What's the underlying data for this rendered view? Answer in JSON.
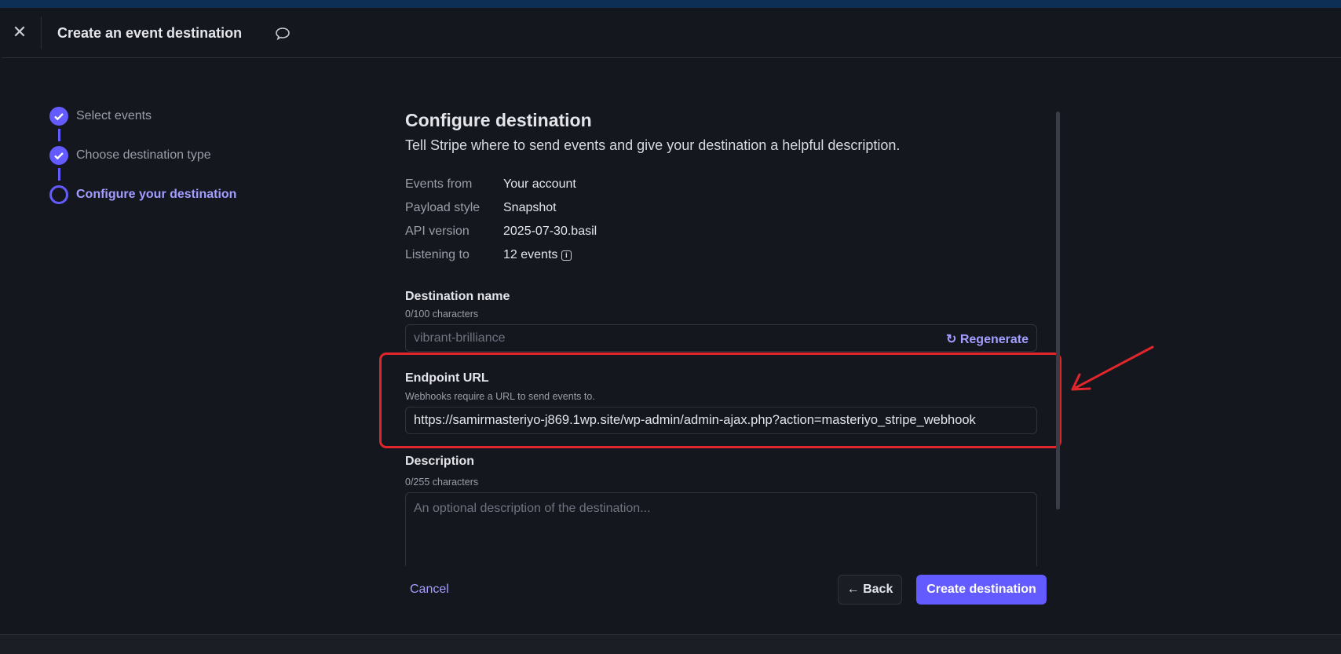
{
  "header": {
    "title": "Create an event destination"
  },
  "steps": [
    {
      "label": "Select events",
      "state": "done"
    },
    {
      "label": "Choose destination type",
      "state": "done"
    },
    {
      "label": "Configure your destination",
      "state": "current"
    }
  ],
  "main": {
    "heading": "Configure destination",
    "subtitle": "Tell Stripe where to send events and give your destination a helpful description.",
    "meta": [
      {
        "label": "Events from",
        "value": "Your account"
      },
      {
        "label": "Payload style",
        "value": "Snapshot"
      },
      {
        "label": "API version",
        "value": "2025-07-30.basil"
      },
      {
        "label": "Listening to",
        "value": "12 events"
      }
    ],
    "dest_name": {
      "label": "Destination name",
      "count": "0/100 characters",
      "placeholder": "vibrant-brilliance",
      "regenerate": "Regenerate"
    },
    "endpoint": {
      "label": "Endpoint URL",
      "help": "Webhooks require a URL to send events to.",
      "value": "https://samirmasteriyo-j869.1wp.site/wp-admin/admin-ajax.php?action=masteriyo_stripe_webhook"
    },
    "description": {
      "label": "Description",
      "count": "0/255 characters",
      "placeholder": "An optional description of the destination..."
    }
  },
  "footer": {
    "cancel": "Cancel",
    "back": "Back",
    "create": "Create destination"
  },
  "colors": {
    "accent": "#635bff",
    "highlight": "#e0262b"
  }
}
